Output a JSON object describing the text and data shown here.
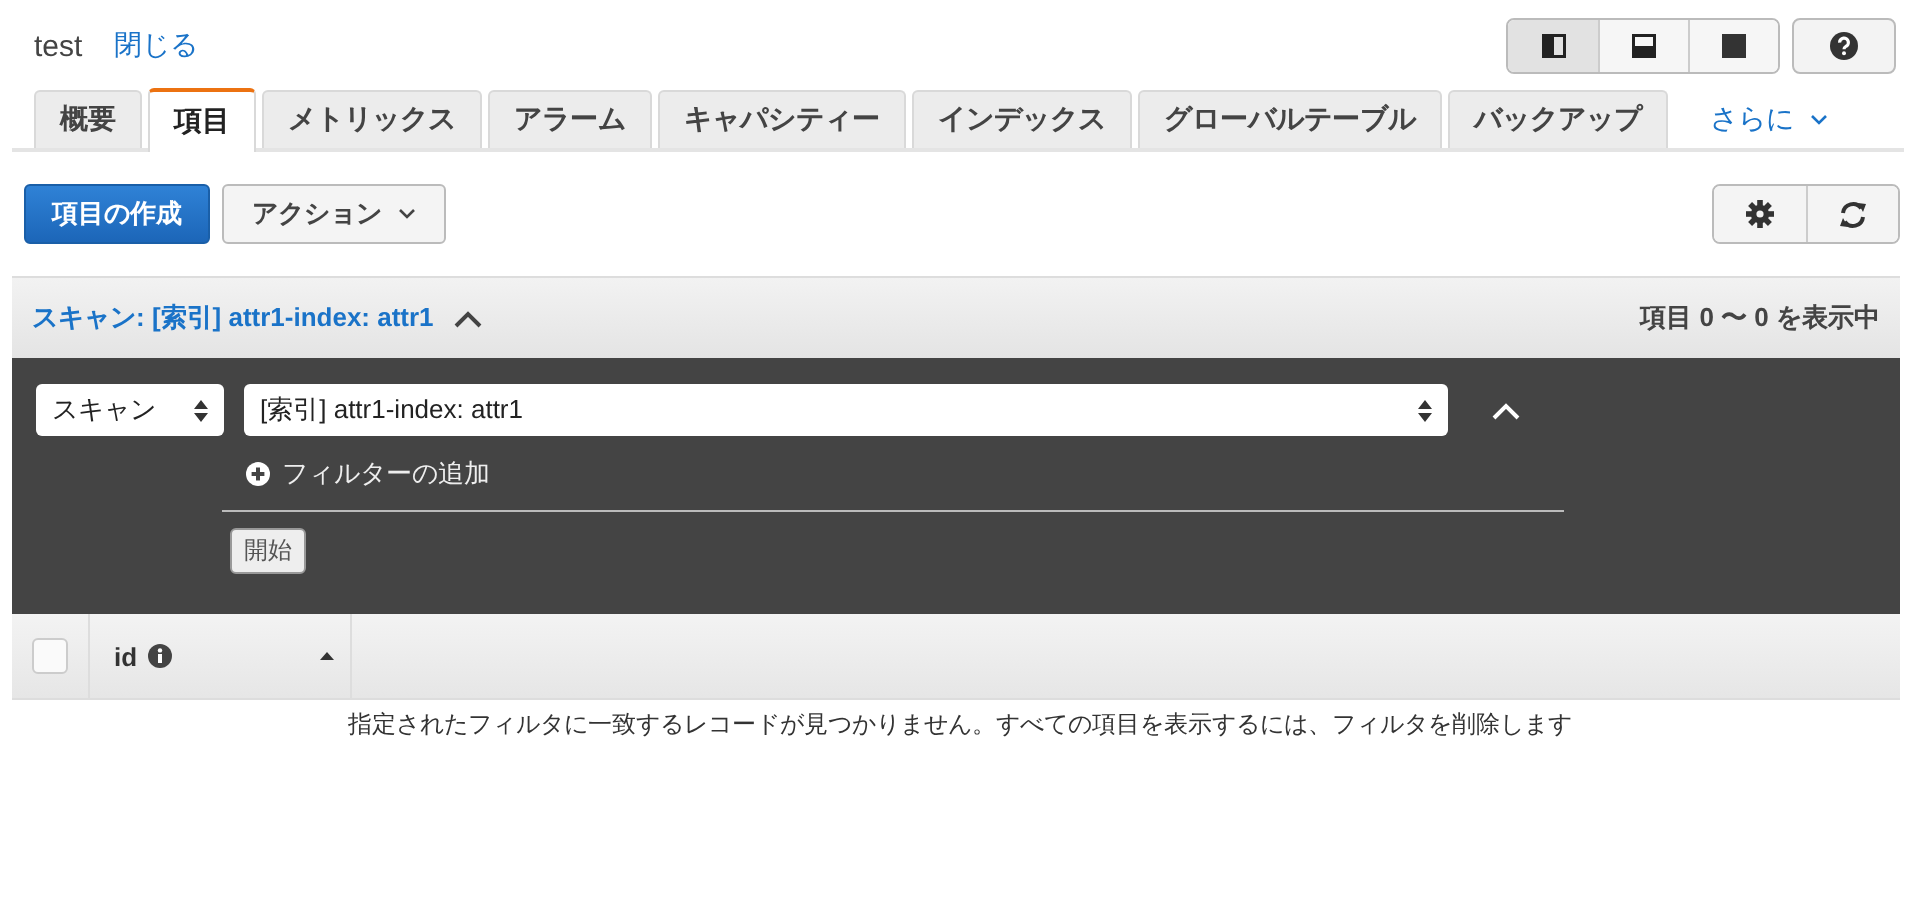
{
  "header": {
    "title": "test",
    "close_link": "閉じる"
  },
  "view_modes": [
    {
      "kind": "split-left",
      "selected": true
    },
    {
      "kind": "split-bottom",
      "selected": false
    },
    {
      "kind": "full",
      "selected": false
    }
  ],
  "tabs": [
    {
      "label": "概要",
      "selected": false
    },
    {
      "label": "項目",
      "selected": true
    },
    {
      "label": "メトリックス",
      "selected": false
    },
    {
      "label": "アラーム",
      "selected": false
    },
    {
      "label": "キャパシティー",
      "selected": false
    },
    {
      "label": "インデックス",
      "selected": false
    },
    {
      "label": "グローバルテーブル",
      "selected": false
    },
    {
      "label": "バックアップ",
      "selected": false
    }
  ],
  "more_tabs": "さらに",
  "toolbar": {
    "create_button": "項目の作成",
    "actions_button": "アクション"
  },
  "scan_header": {
    "title": "スキャン: [索引] attr1-index: attr1",
    "expanded": true,
    "count": "項目 0 〜 0 を表示中"
  },
  "scan_panel": {
    "mode_select": "スキャン",
    "index_select": "[索引] attr1-index: attr1",
    "add_filter": "フィルターの追加",
    "start_button": "開始"
  },
  "table": {
    "select_all_checked": false,
    "columns": [
      {
        "label": "id"
      }
    ]
  },
  "empty_message": "指定されたフィルタに一致するレコードが見つかりません。すべての項目を表示するには、フィルタを削除します"
}
